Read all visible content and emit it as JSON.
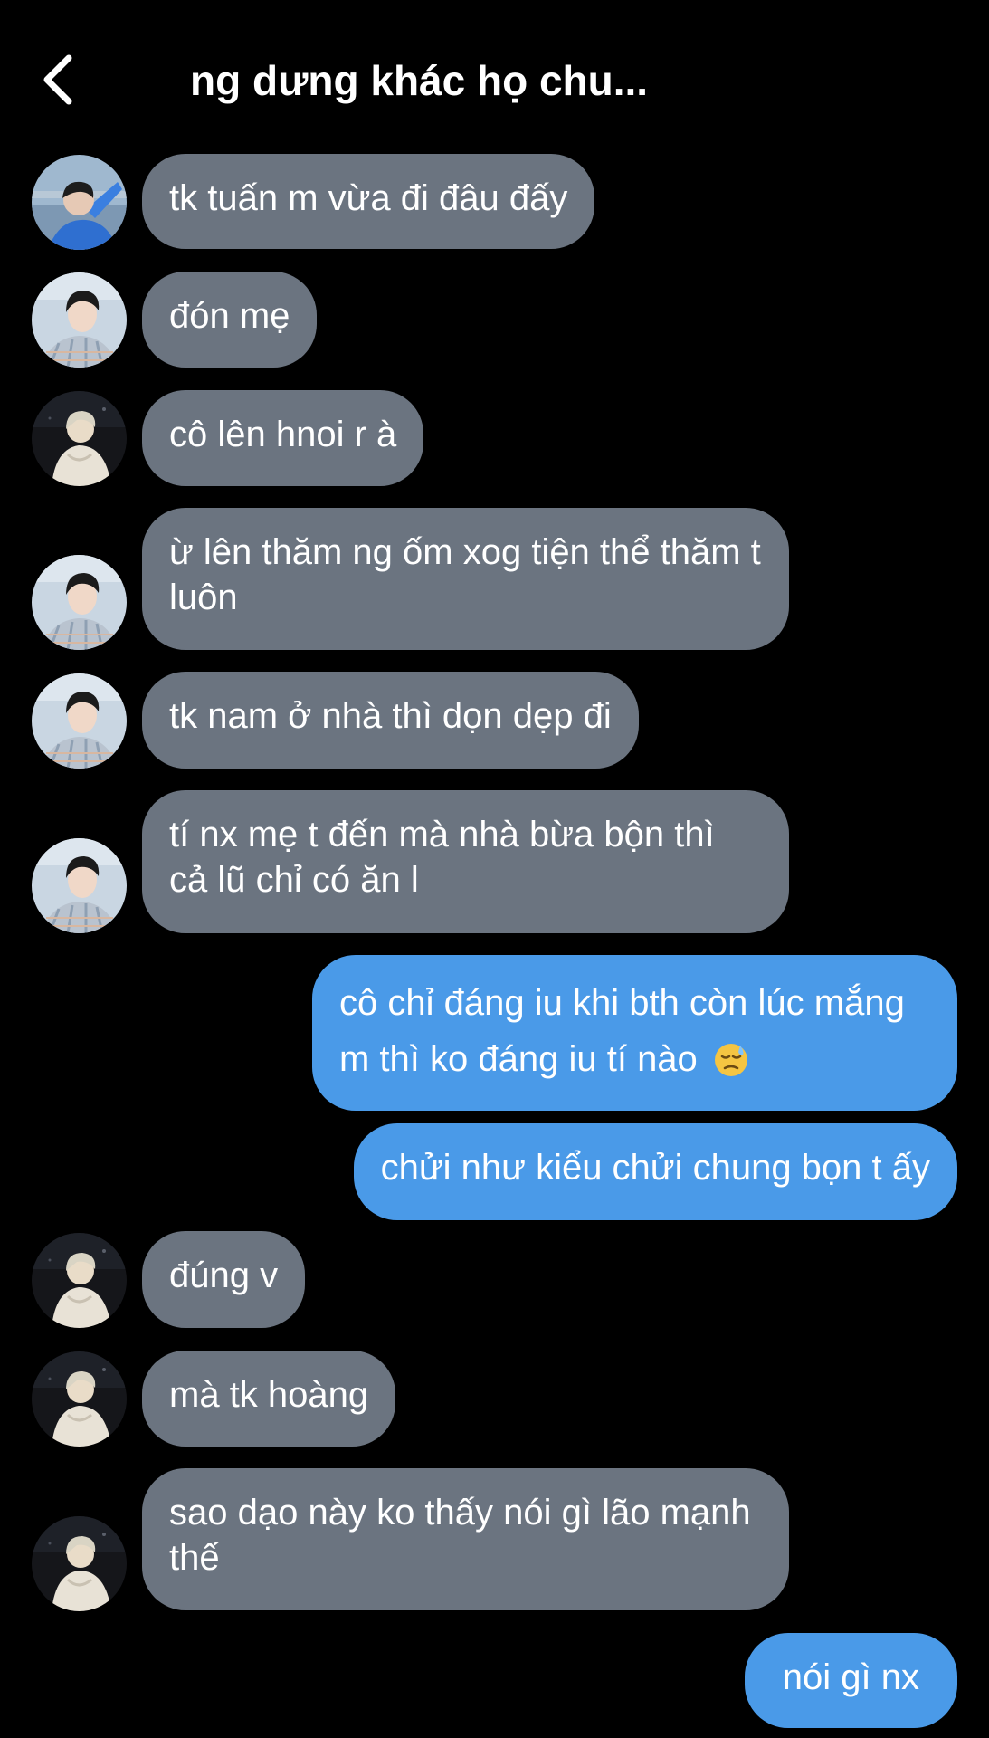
{
  "header": {
    "title": "ng dưng khác họ chu..."
  },
  "colors": {
    "background": "#000000",
    "incoming_bubble": "#6b7480",
    "outgoing_bubble": "#4a9ae8"
  },
  "messages": [
    {
      "direction": "incoming",
      "sender_avatar": "avatar-blue-shirt",
      "text": "tk tuấn m vừa đi đâu đấy"
    },
    {
      "direction": "incoming",
      "sender_avatar": "avatar-plaid-shirt",
      "text": "đón mẹ"
    },
    {
      "direction": "incoming",
      "sender_avatar": "avatar-white-figure",
      "text": "cô lên hnoi r à"
    },
    {
      "direction": "incoming",
      "sender_avatar": "avatar-plaid-shirt",
      "text": "ừ lên thăm ng ốm xog tiện thể thăm t luôn"
    },
    {
      "direction": "incoming",
      "sender_avatar": "avatar-plaid-shirt",
      "text": "tk nam ở nhà thì dọn dẹp đi"
    },
    {
      "direction": "incoming",
      "sender_avatar": "avatar-plaid-shirt",
      "text": "tí nx mẹ t đến mà nhà bừa bộn thì cả lũ chỉ có ăn l"
    },
    {
      "direction": "outgoing",
      "text": "cô chỉ đáng iu khi bth còn lúc mắng m thì ko đáng iu tí nào",
      "emoji": "downcast-sweat-emoji"
    },
    {
      "direction": "outgoing",
      "text": "chửi như kiểu chửi chung bọn t ấy"
    },
    {
      "direction": "incoming",
      "sender_avatar": "avatar-white-figure",
      "text": "đúng v"
    },
    {
      "direction": "incoming",
      "sender_avatar": "avatar-white-figure",
      "text": "mà tk hoàng"
    },
    {
      "direction": "incoming",
      "sender_avatar": "avatar-white-figure",
      "text": "sao dạo này ko thấy nói gì lão mạnh thế"
    },
    {
      "direction": "outgoing",
      "text": "nói gì nx"
    }
  ]
}
